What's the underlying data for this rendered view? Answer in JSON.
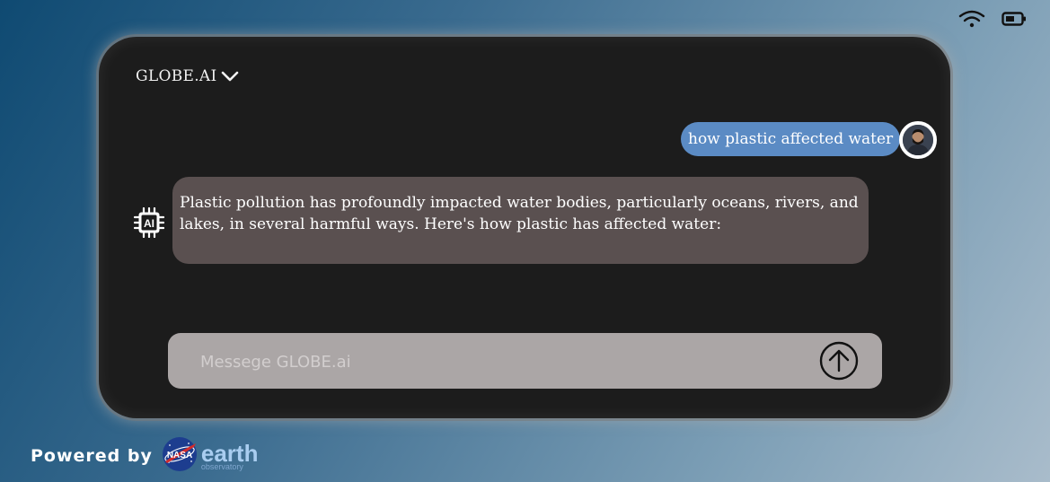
{
  "status": {
    "wifi_icon": "wifi-icon",
    "battery_icon": "battery-icon"
  },
  "header": {
    "brand": "GLOBE.AI",
    "dropdown_icon": "chevron-down-icon"
  },
  "chat": {
    "user_message": "how plastic affected water",
    "ai_message": "Plastic pollution has profoundly impacted water bodies, particularly oceans, rivers, and lakes, in several harmful ways. Here's how plastic has affected water:",
    "ai_icon": "ai-chip-icon",
    "avatar": "user-avatar"
  },
  "composer": {
    "placeholder": "Messege GLOBE.ai",
    "value": "",
    "send_icon": "arrow-up-circle-icon"
  },
  "footer": {
    "powered_by": "Powered by",
    "nasa_text": "NASA",
    "earth_text": "earth",
    "observatory_text": "observatory"
  },
  "colors": {
    "user_bubble": "#5b8bc4",
    "ai_bubble": "#5a5050",
    "panel": "#1c1c1c",
    "input": "#aba6a6"
  }
}
